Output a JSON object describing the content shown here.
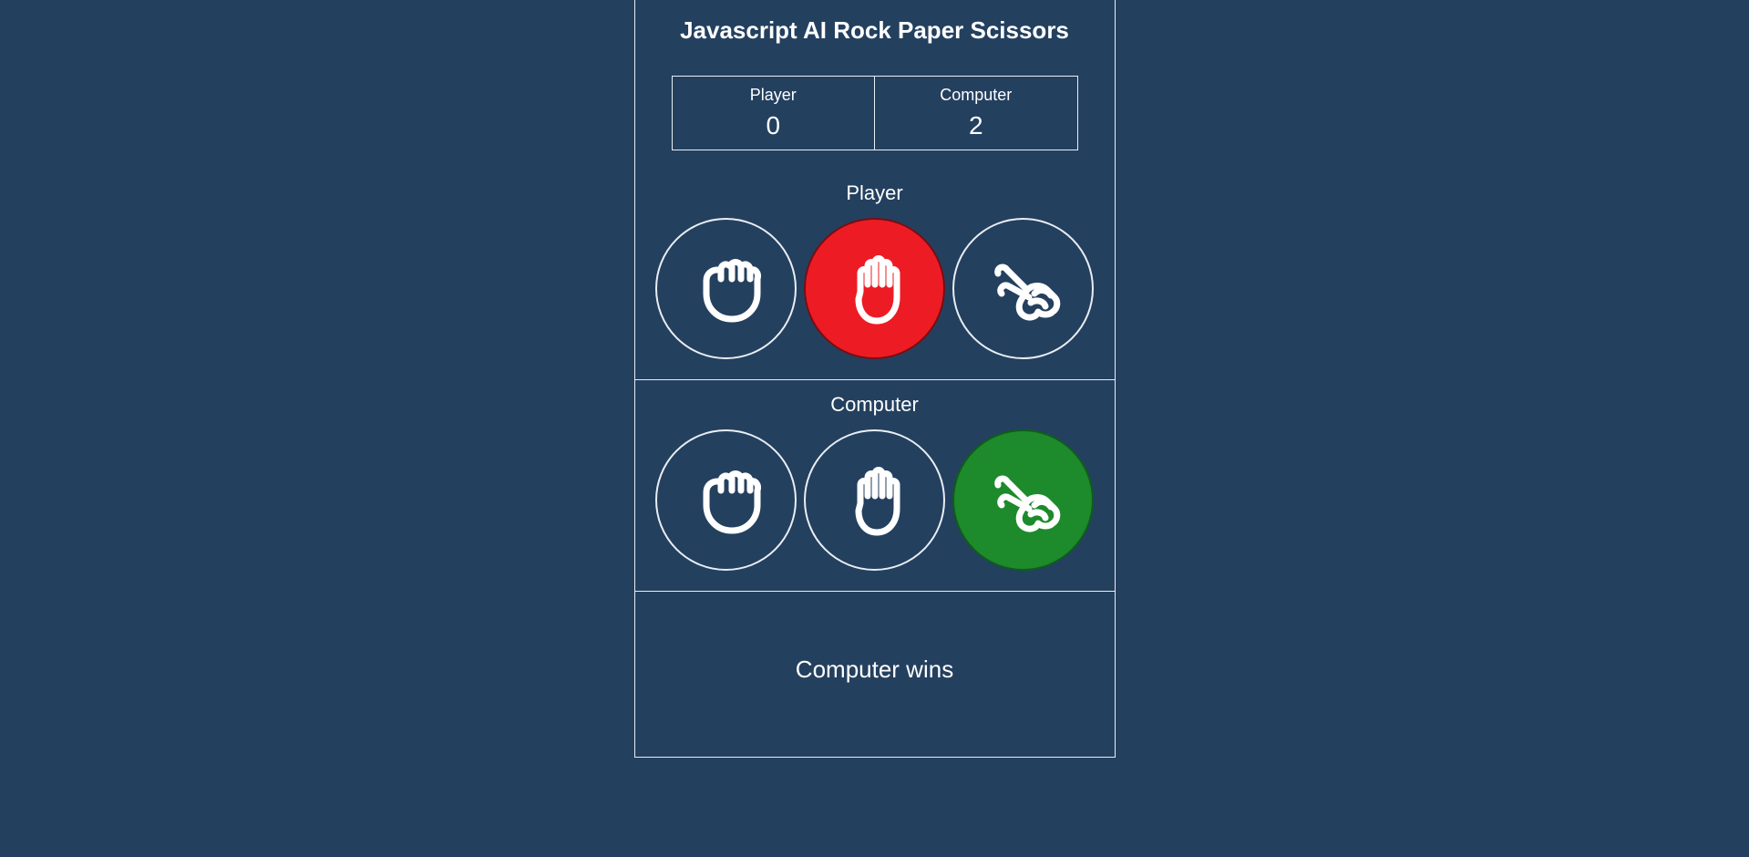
{
  "title": "Javascript AI Rock Paper Scissors",
  "scoreboard": {
    "player_label": "Player",
    "computer_label": "Computer",
    "player_score": "0",
    "computer_score": "2"
  },
  "player_section": {
    "label": "Player",
    "selected": "paper",
    "outcome": "lose"
  },
  "computer_section": {
    "label": "Computer",
    "selected": "scissors",
    "outcome": "win"
  },
  "result": {
    "message": "Computer wins"
  }
}
